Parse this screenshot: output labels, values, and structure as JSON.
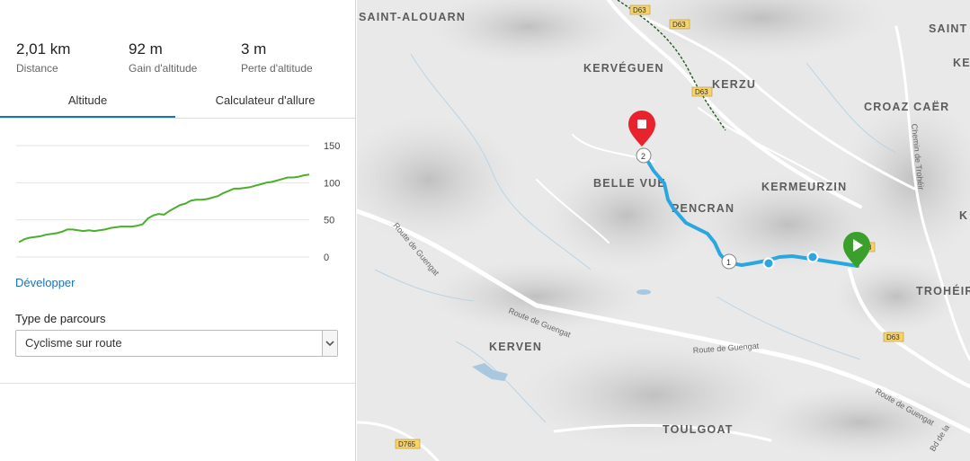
{
  "stats": [
    {
      "value": "2,01 km",
      "label": "Distance"
    },
    {
      "value": "92 m",
      "label": "Gain d'altitude"
    },
    {
      "value": "3 m",
      "label": "Perte d'altitude"
    }
  ],
  "tabs": [
    "Altitude",
    "Calculateur d'allure"
  ],
  "chart_data": {
    "type": "line",
    "title": "",
    "xlabel": "",
    "ylabel": "",
    "ylim": [
      0,
      150
    ],
    "yticks": [
      "150",
      "100",
      "50",
      "0"
    ],
    "color": "#4caf2a",
    "grid": true,
    "series": [
      {
        "values": [
          20,
          24,
          26,
          27,
          28,
          30,
          31,
          32,
          34,
          37,
          37,
          36,
          35,
          36,
          35,
          36,
          37,
          39,
          40,
          41,
          41,
          41,
          42,
          44,
          52,
          56,
          58,
          57,
          62,
          66,
          70,
          72,
          76,
          77,
          77,
          78,
          80,
          82,
          86,
          89,
          92,
          92,
          93,
          94,
          96,
          98,
          100,
          101,
          103,
          105,
          107,
          107,
          108,
          110,
          111
        ]
      }
    ]
  },
  "develop_link": "Développer",
  "route_type": {
    "label": "Type de parcours",
    "selected": "Cyclisme sur route"
  },
  "map": {
    "places": [
      "SAINT-ALOUARN",
      "KERVÉGUEN",
      "KERZU",
      "CROAZ CAËR",
      "BELLE VUE",
      "KERMEURZIN",
      "PENCRAN",
      "TROHÉIR",
      "KERVEN",
      "TOULGOAT",
      "SAINT",
      "KE",
      "K"
    ],
    "roads": [
      "Route de Guengat",
      "Route de Guengat",
      "Route de Guengat",
      "Route de Guengat",
      "Chemin de Trohéir",
      "Bd de la"
    ],
    "shields": [
      "D63",
      "D63",
      "D63",
      "D63",
      "D765",
      "3"
    ],
    "markers": {
      "start": "start-marker",
      "end": "end-marker",
      "km1": "1",
      "km2": "2"
    },
    "route_color": "#2aa7e0"
  }
}
